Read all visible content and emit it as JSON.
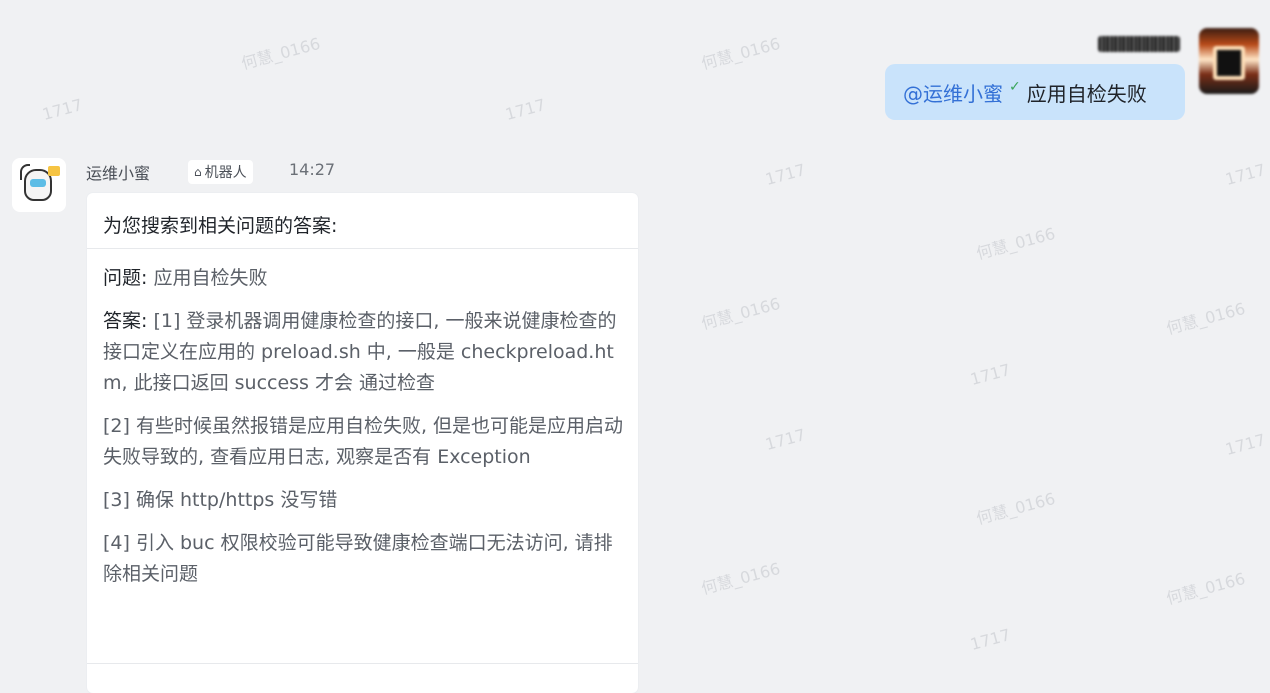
{
  "sent_message": {
    "mention": "@运维小蜜",
    "text": "应用自检失败"
  },
  "bot_message": {
    "sender": "运维小蜜",
    "tag": "机器人",
    "time": "14:27",
    "card": {
      "header": "为您搜索到相关问题的答案:",
      "question_label": "问题:",
      "question_text": "应用自检失败",
      "answer_label": "答案:",
      "answer_1": "[1] 登录机器调用健康检查的接口, 一般来说健康检查的接口定义在应用的 preload.sh 中, 一般是 checkpreload.htm, 此接口返回 success 才会 通过检查",
      "answer_2": "[2] 有些时候虽然报错是应用自检失败, 但是也可能是应用启动失败导致的, 查看应用日志, 观察是否有 Exception",
      "answer_3": "[3] 确保 http/https 没写错",
      "answer_4": "[4] 引入 buc 权限校验可能导致健康检查端口无法访问, 请排除相关问题"
    }
  },
  "watermark": {
    "name": "何慧_0166",
    "code": "1717"
  }
}
